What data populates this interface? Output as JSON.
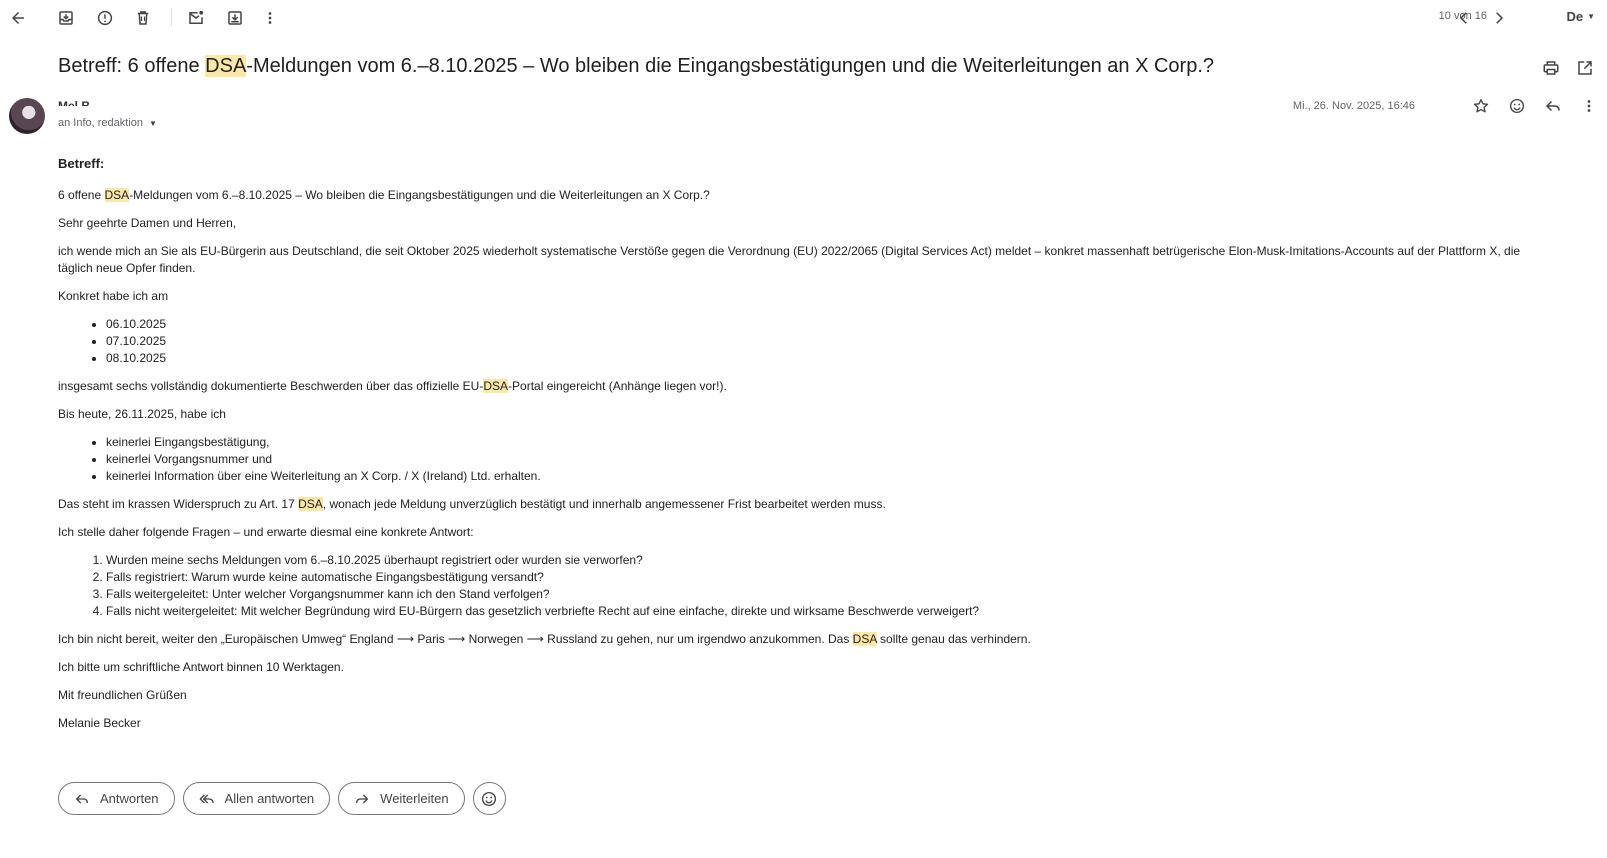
{
  "toolbar": {
    "icons": [
      "back-arrow-icon",
      "archive-icon",
      "report-spam-icon",
      "delete-icon",
      "mark-unread-icon",
      "move-to-icon",
      "more-vert-icon"
    ],
    "pager": "10 von 16",
    "language": "De"
  },
  "subject": {
    "prefix": "Betreff: 6 offene ",
    "highlight": "DSA",
    "suffix": "-Meldungen vom 6.–8.10.2025 – Wo bleiben die Eingangsbestätigungen und die Weiterleitungen an X Corp.?"
  },
  "sender": {
    "name": "Mel B",
    "recipients": "an Info, redaktion",
    "date": "Mi., 26. Nov. 2025, 16:46"
  },
  "body": {
    "heading": "Betreff:",
    "subject_line": {
      "pre": "6 offene ",
      "hl": "DSA",
      "post": "-Meldungen vom 6.–8.10.2025 – Wo bleiben die Eingangsbestätigungen und die Weiterleitungen an X Corp.?"
    },
    "greeting": "Sehr geehrte Damen und Herren,",
    "intro": "ich wende mich an Sie als EU-Bürgerin aus Deutschland, die seit Oktober 2025 wiederholt systematische Verstöße gegen die Verordnung (EU) 2022/2065 (Digital Services Act) meldet – konkret massenhaft betrügerische Elon-Musk-Imitations-Accounts auf der Plattform X, die täglich neue Opfer finden.",
    "konkret": "Konkret habe ich am",
    "dates": [
      "06.10.2025",
      "07.10.2025",
      "08.10.2025"
    ],
    "submitted": {
      "pre": "insgesamt sechs vollständig dokumentierte Beschwerden über das offizielle EU-",
      "hl": "DSA",
      "post": "-Portal eingereicht (Anhänge liegen vor!)."
    },
    "bis_heute": "Bis heute, 26.11.2025, habe ich",
    "missing": [
      "keinerlei Eingangsbestätigung,",
      "keinerlei Vorgangsnummer und",
      "keinerlei Information über eine Weiterleitung an X Corp. / X (Ireland) Ltd. erhalten."
    ],
    "contradiction": {
      "pre": "Das steht im krassen Widerspruch zu Art. 17 ",
      "hl": "DSA",
      "post": ", wonach jede Meldung unverzüglich bestätigt und innerhalb angemessener Frist bearbeitet werden muss."
    },
    "questions_intro": "Ich stelle daher folgende Fragen – und erwarte diesmal eine konkrete Antwort:",
    "questions": [
      "Wurden meine sechs Meldungen vom 6.–8.10.2025 überhaupt registriert oder wurden sie verworfen?",
      "Falls registriert: Warum wurde keine automatische Eingangsbestätigung versandt?",
      "Falls weitergeleitet: Unter welcher Vorgangsnummer kann ich den Stand verfolgen?",
      "Falls nicht weitergeleitet: Mit welcher Begründung wird EU-Bürgern das gesetzlich verbriefte Recht auf eine einfache, direkte und wirksame Beschwerde verweigert?"
    ],
    "detour": {
      "pre": "Ich bin nicht bereit, weiter den „Europäischen Umweg“ England ⟶ Paris ⟶ Norwegen ⟶ Russland zu gehen, nur um irgendwo anzukommen. Das ",
      "hl": "DSA",
      "post": " sollte genau das verhindern."
    },
    "request": "Ich bitte um schriftliche Antwort binnen 10 Werktagen.",
    "closing": "Mit freundlichen Grüßen",
    "signature": "Melanie Becker"
  },
  "actions": {
    "reply": "Antworten",
    "reply_all": "Allen antworten",
    "forward": "Weiterleiten"
  }
}
